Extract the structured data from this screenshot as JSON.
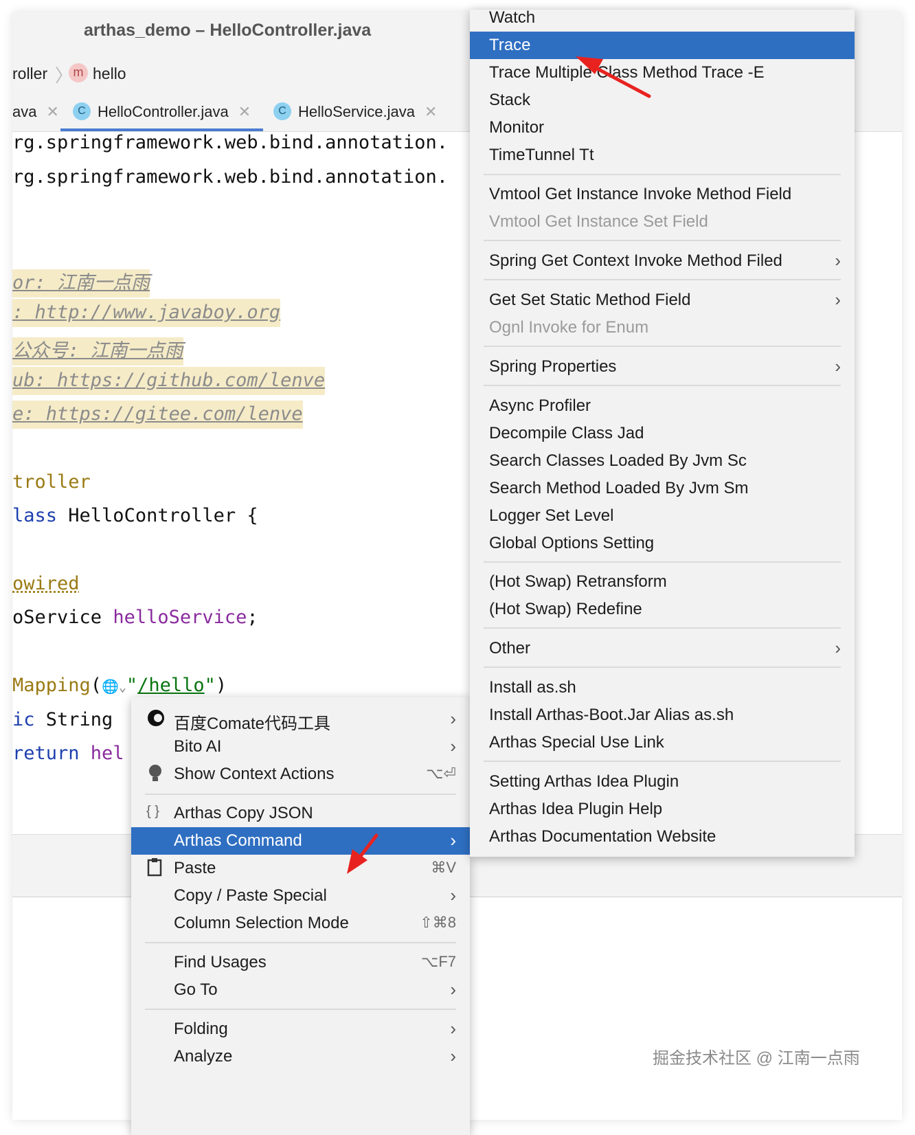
{
  "window": {
    "title": "arthas_demo – HelloController.java"
  },
  "breadcrumb": {
    "items": [
      "roller",
      "hello"
    ],
    "method_badge": "m"
  },
  "tabs": [
    {
      "label": "ava",
      "close": "✕"
    },
    {
      "label": "HelloController.java",
      "badge": "C",
      "close": "✕",
      "active": true
    },
    {
      "label": "HelloService.java",
      "badge": "C",
      "close": "✕"
    }
  ],
  "code": {
    "line1": "rg.springframework.web.bind.annotation.",
    "line2": "rg.springframework.web.bind.annotation.",
    "c1": "or: 江南一点雨",
    "c2": ": http://www.javaboy.org",
    "c3": "公众号: 江南一点雨",
    "c4": "ub: https://github.com/lenve",
    "c5": "e: https://gitee.com/lenve",
    "ann_controller": "troller",
    "class_kw": "lass",
    "class_rest": " HelloController {",
    "ann_autowired": "owired",
    "field_type": "oService ",
    "field_name": "helloService",
    "field_semicolon": ";",
    "mapping_ann": "Mapping",
    "mapping_open": "(",
    "mapping_quote_open": "\"",
    "mapping_path": "/hello",
    "mapping_quote_close": "\"",
    "mapping_close": ")",
    "method_kw": "ic",
    "method_rest": " String ",
    "return_kw": "return",
    "return_rest": " hel"
  },
  "menu_left": {
    "items": [
      {
        "label": "百度Comate代码工具",
        "submenu": true,
        "icon": "comate-icon"
      },
      {
        "label": "Bito AI",
        "submenu": true
      },
      {
        "label": "Show Context Actions",
        "shortcut": "⌥⏎",
        "icon": "bulb-icon"
      },
      {
        "label": "Arthas Copy JSON",
        "icon": "braces-icon"
      },
      {
        "label": "Arthas Command",
        "submenu": true,
        "selected": true
      },
      {
        "label": "Paste",
        "shortcut": "⌘V",
        "icon": "clipboard-icon"
      },
      {
        "label": "Copy / Paste Special",
        "submenu": true
      },
      {
        "label": "Column Selection Mode",
        "shortcut": "⇧⌘8"
      },
      {
        "label": "Find Usages",
        "shortcut": "⌥F7"
      },
      {
        "label": "Go To",
        "submenu": true
      },
      {
        "label": "Folding",
        "submenu": true
      },
      {
        "label": "Analyze",
        "submenu": true
      }
    ],
    "braces_glyph": "{ }"
  },
  "menu_right": {
    "items": [
      {
        "label": "Watch"
      },
      {
        "label": "Trace",
        "selected": true
      },
      {
        "label": "Trace Multiple Class Method Trace -E"
      },
      {
        "label": "Stack"
      },
      {
        "label": "Monitor"
      },
      {
        "label": "TimeTunnel Tt"
      },
      {
        "label": "Vmtool Get Instance Invoke Method Field"
      },
      {
        "label": "Vmtool Get Instance Set Field",
        "disabled": true
      },
      {
        "label": "Spring Get Context Invoke Method Filed",
        "submenu": true
      },
      {
        "label": "Get Set Static Method Field",
        "submenu": true
      },
      {
        "label": "Ognl Invoke for Enum",
        "disabled": true
      },
      {
        "label": "Spring Properties",
        "submenu": true
      },
      {
        "label": "Async Profiler"
      },
      {
        "label": "Decompile Class Jad"
      },
      {
        "label": "Search Classes Loaded By Jvm Sc"
      },
      {
        "label": "Search Method Loaded By Jvm Sm"
      },
      {
        "label": "Logger Set Level"
      },
      {
        "label": "Global Options Setting"
      },
      {
        "label": "(Hot Swap) Retransform"
      },
      {
        "label": "(Hot Swap) Redefine"
      },
      {
        "label": "Other",
        "submenu": true
      },
      {
        "label": "Install as.sh"
      },
      {
        "label": "Install Arthas-Boot.Jar Alias as.sh"
      },
      {
        "label": "Arthas Special Use Link"
      },
      {
        "label": "Setting Arthas Idea Plugin"
      },
      {
        "label": "Arthas Idea Plugin Help"
      },
      {
        "label": "Arthas Documentation Website"
      }
    ]
  },
  "icons": {
    "chevron": "›",
    "globe": "🌐",
    "breadcrumb_sep": "〉"
  },
  "colors": {
    "selection": "#2f6fc2",
    "arrow": "#e8231f",
    "comment_highlight": "#f5ebc7"
  },
  "watermark": "掘金技术社区 @ 江南一点雨"
}
